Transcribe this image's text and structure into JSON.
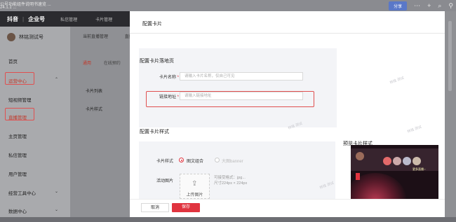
{
  "browser": {
    "tab_text": "公号功能组件说明书速览 ...",
    "tab_text_2": "24.1.1 ...",
    "top_button": "分享"
  },
  "app": {
    "logo_douyin": "抖音",
    "logo_enterprise": "企业号",
    "nav": [
      "私信管理",
      "卡片管理"
    ]
  },
  "sidebar": {
    "account_name": "林铭测试号",
    "items": [
      {
        "label": "首页"
      },
      {
        "label": "运营中心"
      },
      {
        "label": "短视频管理"
      },
      {
        "label": "直播管理"
      },
      {
        "label": "主页管理"
      },
      {
        "label": "私信管理"
      },
      {
        "label": "用户管理"
      },
      {
        "label": "经营工具中心"
      },
      {
        "label": "数据中心"
      }
    ]
  },
  "main": {
    "tabs": [
      "当前直播管理",
      "直播"
    ],
    "subtabs": [
      "通用",
      "在线预约"
    ],
    "labels": [
      "卡片列表",
      "卡片样式"
    ]
  },
  "modal": {
    "title": "配置卡片",
    "section1_title": "配置卡片落地页",
    "card_name_label": "卡片名称",
    "card_name_placeholder": "请输入卡片名称，仅自己可见",
    "link_label": "链接地址",
    "link_placeholder": "请输入链接地址",
    "section2_title": "配置卡片样式",
    "style_label": "卡片样式",
    "style_option_1": "图文组合",
    "style_option_2": "大图banner",
    "image_label": "活动图片",
    "upload_text": "上传图片",
    "hint_1": "可接受格式：jpg...",
    "hint_2": "尺寸224px × 224px",
    "preview_title": "预览卡片样式",
    "preview_more": "更多直播 ›",
    "cancel": "取消",
    "save": "保存",
    "required_mark": "*"
  },
  "watermark": "林铭 测试",
  "accent": "#e0343f"
}
